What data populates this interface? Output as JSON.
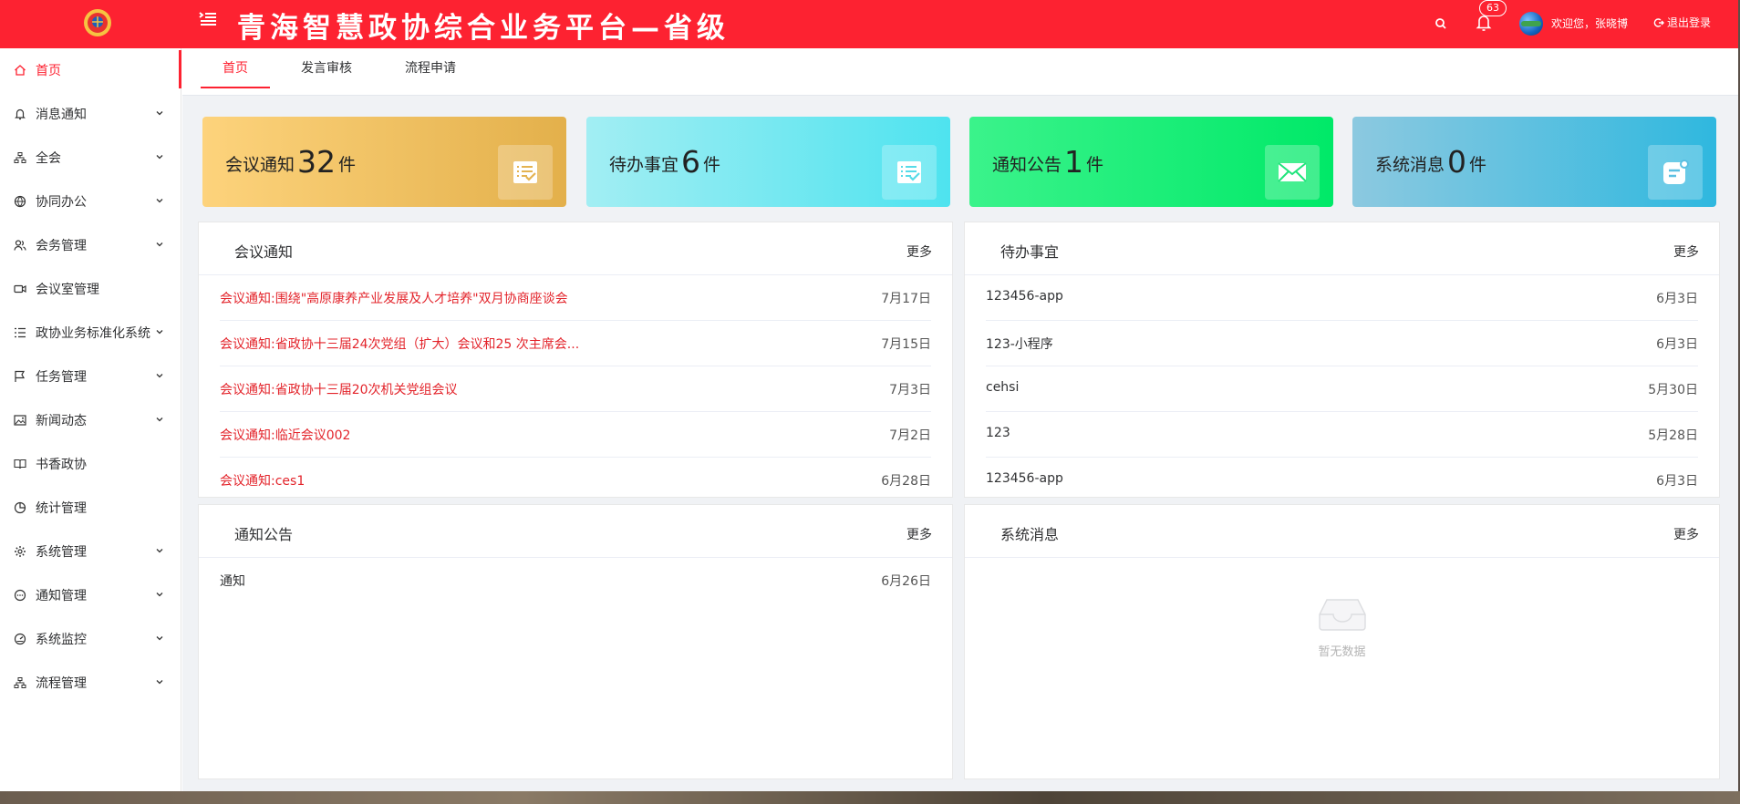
{
  "header": {
    "title": "青海智慧政协综合业务平台—省级",
    "bell_count": "63",
    "welcome": "欢迎您，张晓博",
    "logout": "退出登录",
    "accent": "#fd2231"
  },
  "sidebar": {
    "items": [
      {
        "label": "首页",
        "icon": "home-icon",
        "active": true,
        "expand": false
      },
      {
        "label": "消息通知",
        "icon": "bell-icon",
        "expand": true
      },
      {
        "label": "全会",
        "icon": "sitemap-icon",
        "expand": true
      },
      {
        "label": "协同办公",
        "icon": "globe-icon",
        "expand": true
      },
      {
        "label": "会务管理",
        "icon": "users-icon",
        "expand": true
      },
      {
        "label": "会议室管理",
        "icon": "video-icon",
        "expand": false
      },
      {
        "label": "政协业务标准化系统",
        "icon": "list-icon",
        "expand": true
      },
      {
        "label": "任务管理",
        "icon": "flag-icon",
        "expand": true
      },
      {
        "label": "新闻动态",
        "icon": "image-icon",
        "expand": true
      },
      {
        "label": "书香政协",
        "icon": "book-icon",
        "expand": false
      },
      {
        "label": "统计管理",
        "icon": "pie-chart-icon",
        "expand": false
      },
      {
        "label": "系统管理",
        "icon": "gear-icon",
        "expand": true
      },
      {
        "label": "通知管理",
        "icon": "chat-icon",
        "expand": true
      },
      {
        "label": "系统监控",
        "icon": "dashboard-icon",
        "expand": true
      },
      {
        "label": "流程管理",
        "icon": "sitemap-icon",
        "expand": true
      }
    ]
  },
  "tabs": [
    {
      "label": "首页",
      "active": true
    },
    {
      "label": "发言审核",
      "active": false
    },
    {
      "label": "流程申请",
      "active": false
    }
  ],
  "stats": [
    {
      "label": "会议通知",
      "count": "32",
      "unit": "件",
      "icon": "checklist-icon"
    },
    {
      "label": "待办事宜",
      "count": "6",
      "unit": "件",
      "icon": "checklist-icon"
    },
    {
      "label": "通知公告",
      "count": "1",
      "unit": "件",
      "icon": "mail-icon"
    },
    {
      "label": "系统消息",
      "count": "0",
      "unit": "件",
      "icon": "message-icon"
    }
  ],
  "panels": {
    "meeting": {
      "title": "会议通知",
      "more": "更多",
      "rows": [
        {
          "title": "会议通知:围绕\"高原康养产业发展及人才培养\"双月协商座谈会",
          "date": "7月17日"
        },
        {
          "title": "会议通知:省政协十三届24次党组（扩大）会议和25 次主席会...",
          "date": "7月15日"
        },
        {
          "title": "会议通知:省政协十三届20次机关党组会议",
          "date": "7月3日"
        },
        {
          "title": "会议通知:临近会议002",
          "date": "7月2日"
        },
        {
          "title": "会议通知:ces1",
          "date": "6月28日"
        }
      ]
    },
    "todo": {
      "title": "待办事宜",
      "more": "更多",
      "rows": [
        {
          "title": "123456-app",
          "date": "6月3日"
        },
        {
          "title": "123-小程序",
          "date": "6月3日"
        },
        {
          "title": "cehsi",
          "date": "5月30日"
        },
        {
          "title": "123",
          "date": "5月28日"
        },
        {
          "title": "123456-app",
          "date": "6月3日"
        }
      ]
    },
    "notice": {
      "title": "通知公告",
      "more": "更多",
      "rows": [
        {
          "title": "通知",
          "date": "6月26日"
        }
      ]
    },
    "system": {
      "title": "系统消息",
      "more": "更多",
      "empty": "暂无数据"
    }
  }
}
